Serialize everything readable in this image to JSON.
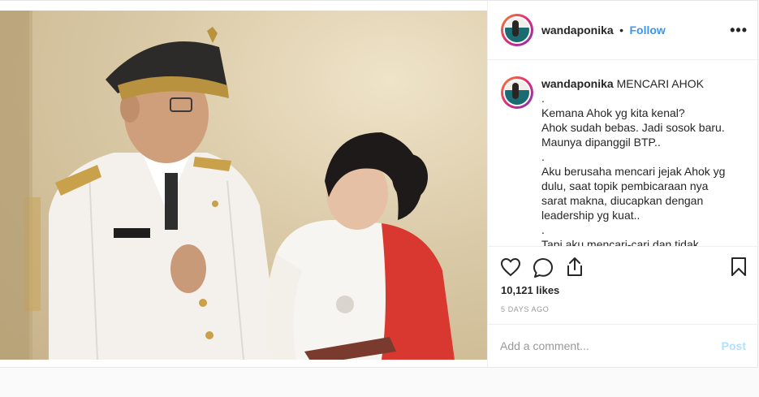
{
  "post": {
    "photo_alt": "Photo",
    "user": {
      "username": "wandaponika",
      "separator": "•",
      "follow_label": "Follow"
    },
    "more_label": "•••",
    "caption": {
      "username": "wandaponika",
      "lines": [
        "MENCARI AHOK",
        ".",
        "Kemana Ahok yg kita kenal?",
        "Ahok sudah bebas. Jadi sosok baru.",
        "Maunya dipanggil BTP..",
        ".",
        "Aku berusaha mencari jejak Ahok yg",
        "dulu, saat topik pembicaraan nya",
        "sarat makna, diucapkan dengan",
        "leadership yg kuat..",
        ".",
        "Tapi aku mencari-cari dan tidak"
      ]
    },
    "actions": {
      "like_icon": "heart-icon",
      "comment_icon": "comment-icon",
      "share_icon": "share-icon",
      "save_icon": "bookmark-icon"
    },
    "likes": "10,121 likes",
    "timestamp": "5 DAYS AGO",
    "comment": {
      "placeholder": "Add a comment...",
      "post_label": "Post"
    }
  }
}
